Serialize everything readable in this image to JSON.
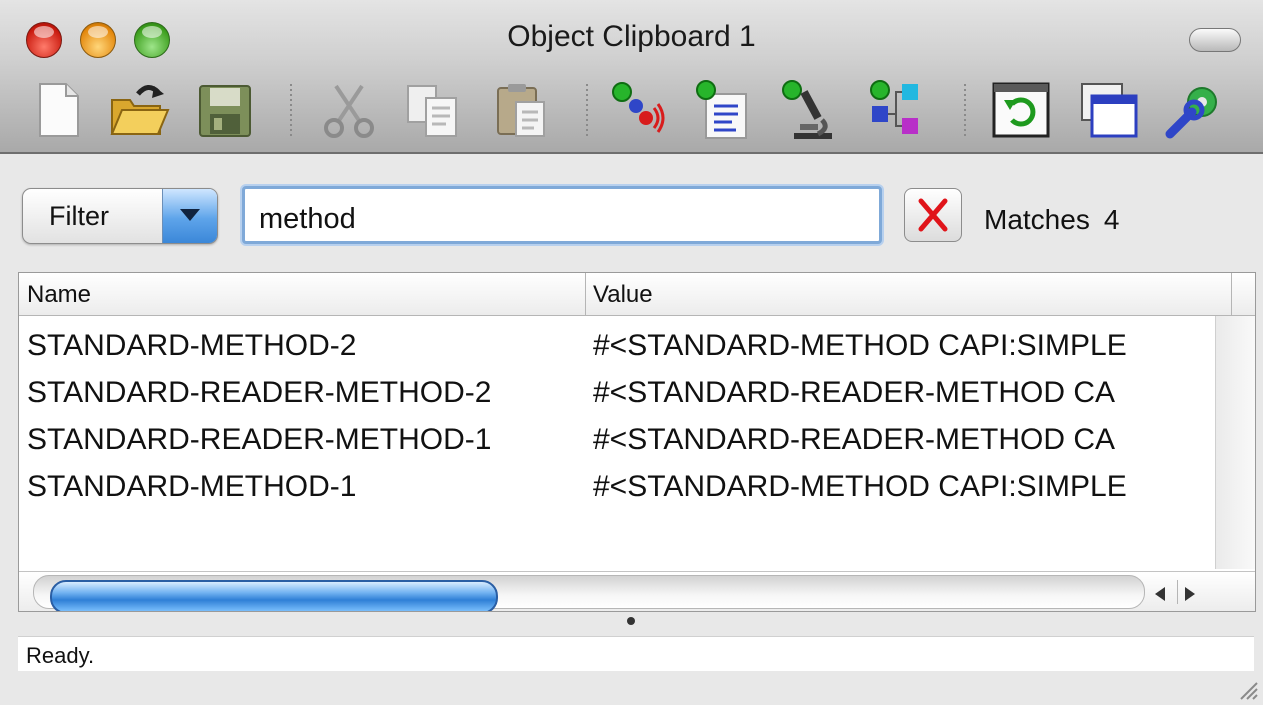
{
  "window": {
    "title": "Object Clipboard 1"
  },
  "toolbar": {
    "items": [
      {
        "name": "new",
        "icon": "new-document-icon"
      },
      {
        "name": "open",
        "icon": "open-folder-icon"
      },
      {
        "name": "save",
        "icon": "floppy-disk-icon"
      },
      {
        "name": "cut",
        "icon": "scissors-icon"
      },
      {
        "name": "copy",
        "icon": "copy-icon"
      },
      {
        "name": "paste",
        "icon": "clipboard-paste-icon"
      },
      {
        "name": "listen",
        "icon": "object-listen-icon"
      },
      {
        "name": "describe",
        "icon": "object-describe-icon"
      },
      {
        "name": "inspect",
        "icon": "microscope-icon"
      },
      {
        "name": "browse",
        "icon": "object-graph-icon"
      },
      {
        "name": "refresh",
        "icon": "refresh-window-icon"
      },
      {
        "name": "clone",
        "icon": "clone-window-icon"
      },
      {
        "name": "preferences",
        "icon": "wrench-gear-icon"
      }
    ]
  },
  "filter": {
    "label": "Filter",
    "query": "method",
    "matches_label": "Matches",
    "matches_count": "4"
  },
  "table": {
    "columns": [
      "Name",
      "Value"
    ],
    "rows": [
      {
        "name": "STANDARD-METHOD-2",
        "value": "#<STANDARD-METHOD CAPI:SIMPLE"
      },
      {
        "name": "STANDARD-READER-METHOD-2",
        "value": "#<STANDARD-READER-METHOD CA"
      },
      {
        "name": "STANDARD-READER-METHOD-1",
        "value": "#<STANDARD-READER-METHOD CA"
      },
      {
        "name": "STANDARD-METHOD-1",
        "value": "#<STANDARD-METHOD CAPI:SIMPLE"
      }
    ],
    "horizontal_scroll_fraction": 0.4
  },
  "status": {
    "text": "Ready."
  },
  "colors": {
    "accent": "#3b87d8",
    "clear_x": "#e0141a"
  }
}
